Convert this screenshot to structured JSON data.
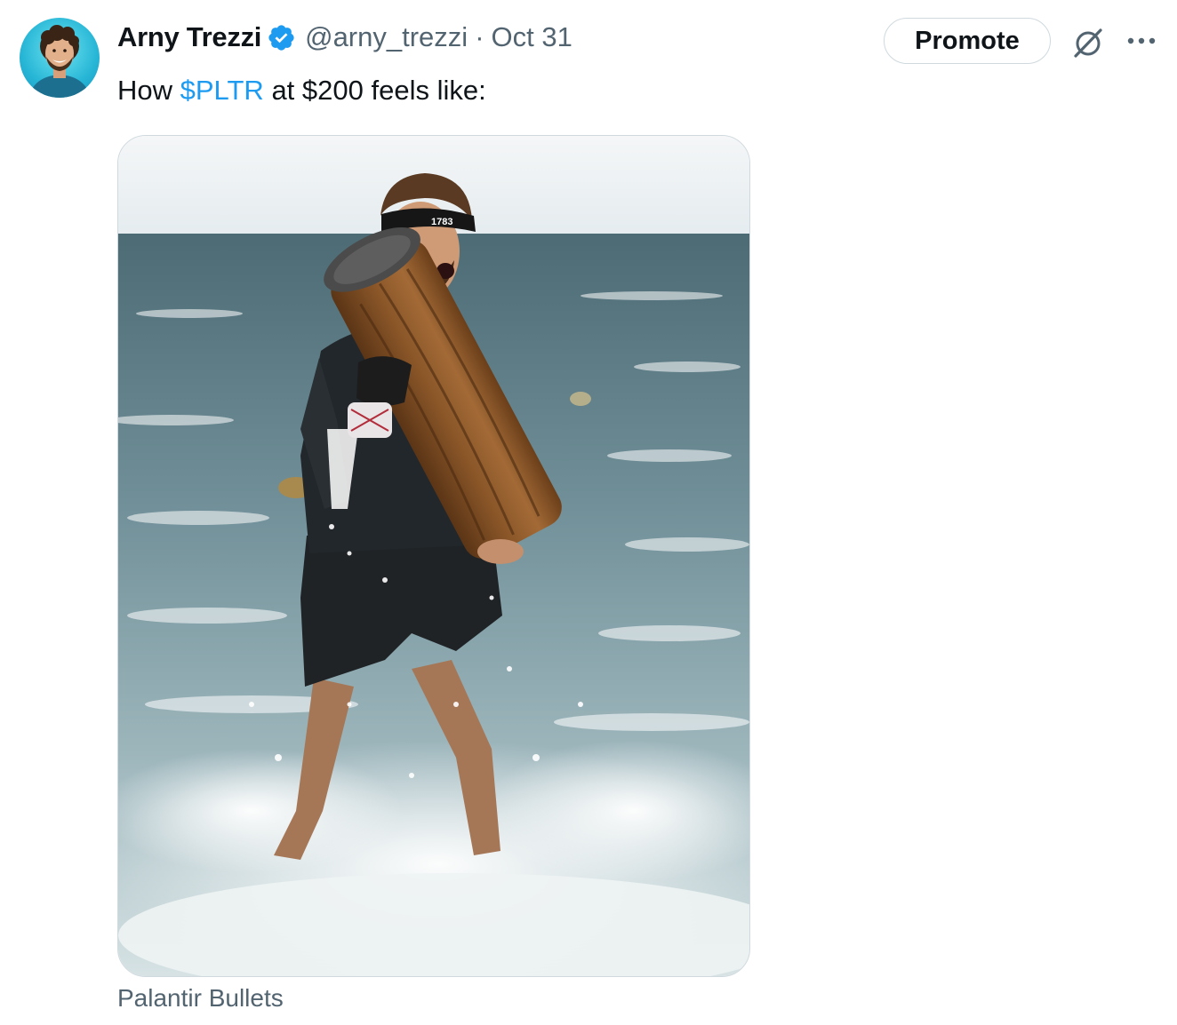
{
  "tweet": {
    "author": {
      "name": "Arny Trezzi",
      "handle": "@arny_trezzi",
      "verified": true,
      "avatar_icon": "profile-photo"
    },
    "separator": "·",
    "date": "Oct 31",
    "text_prefix": "How ",
    "cashtag": "$PLTR",
    "text_suffix": " at $200 feels like:",
    "media": {
      "alt_subject": "photo-man-carrying-log-in-ocean",
      "headband_number": "1783"
    },
    "caption": "Palantir Bullets"
  },
  "actions": {
    "promote_label": "Promote",
    "grok_icon": "grok-icon",
    "more_icon": "more-options-icon"
  },
  "colors": {
    "link": "#1d9bf0",
    "text_primary": "#0f1419",
    "text_secondary": "#536471",
    "border": "#cfd9de",
    "verified": "#1d9bf0"
  }
}
